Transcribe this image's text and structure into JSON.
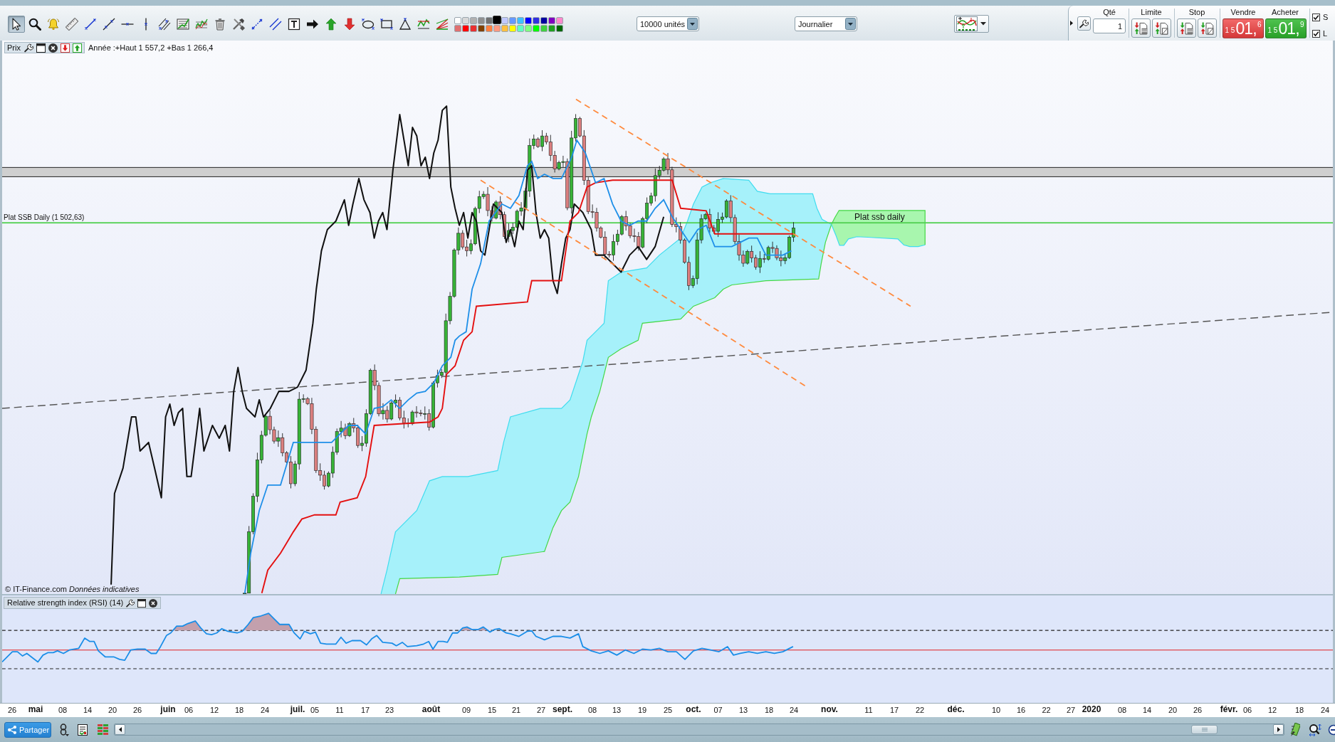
{
  "toolbar": {
    "tools": [
      {
        "kind": "pointer",
        "selected": true
      },
      {
        "kind": "zoom",
        "selected": false
      },
      {
        "kind": "alert",
        "selected": false
      },
      {
        "kind": "ruler",
        "selected": false
      },
      {
        "kind": "segment",
        "selected": false
      },
      {
        "kind": "line",
        "selected": false
      },
      {
        "kind": "horizontal",
        "selected": false
      },
      {
        "kind": "vertical",
        "selected": false
      },
      {
        "kind": "channel",
        "selected": false
      },
      {
        "kind": "retracement",
        "selected": false
      },
      {
        "kind": "waves",
        "selected": false
      },
      {
        "kind": "delete",
        "selected": false
      },
      {
        "kind": "tools",
        "selected": false
      },
      {
        "kind": "ray",
        "selected": false
      },
      {
        "kind": "parallel",
        "selected": false
      },
      {
        "kind": "text",
        "selected": false
      },
      {
        "kind": "arrow",
        "selected": false
      },
      {
        "kind": "up",
        "selected": false
      },
      {
        "kind": "down",
        "selected": false
      },
      {
        "kind": "ellipse",
        "selected": false
      },
      {
        "kind": "rectangle",
        "selected": false
      },
      {
        "kind": "triangle",
        "selected": false
      },
      {
        "kind": "pattern",
        "selected": false
      },
      {
        "kind": "fan",
        "selected": false
      }
    ],
    "palette": [
      {
        "color": "#ffffff",
        "selected": false
      },
      {
        "color": "#d8d8d8",
        "selected": false
      },
      {
        "color": "#b0b0b0",
        "selected": false
      },
      {
        "color": "#909090",
        "selected": false
      },
      {
        "color": "#707070",
        "selected": false
      },
      {
        "color": "#000000",
        "selected": true
      },
      {
        "color": "#c0c8ff",
        "selected": false
      },
      {
        "color": "#6699ff",
        "selected": false
      },
      {
        "color": "#40c0ff",
        "selected": false
      },
      {
        "color": "#0000ff",
        "selected": false
      },
      {
        "color": "#3030e0",
        "selected": false
      },
      {
        "color": "#0000a0",
        "selected": false
      },
      {
        "color": "#8000c0",
        "selected": false
      },
      {
        "color": "#ff88cc",
        "selected": false
      },
      {
        "color": "#e07070",
        "selected": false
      },
      {
        "color": "#ff0000",
        "selected": false
      },
      {
        "color": "#e83030",
        "selected": false
      },
      {
        "color": "#804000",
        "selected": false
      },
      {
        "color": "#ff8040",
        "selected": false
      },
      {
        "color": "#ff9980",
        "selected": false
      },
      {
        "color": "#ffc040",
        "selected": false
      },
      {
        "color": "#ffff00",
        "selected": false
      },
      {
        "color": "#60ffc0",
        "selected": false
      },
      {
        "color": "#80ff80",
        "selected": false
      },
      {
        "color": "#00ff00",
        "selected": false
      },
      {
        "color": "#40d040",
        "selected": false
      },
      {
        "color": "#20a020",
        "selected": false
      },
      {
        "color": "#006600",
        "selected": false
      }
    ],
    "lot_size": {
      "value": "10000 unités"
    },
    "period": {
      "value": "Journalier"
    }
  },
  "order_panel": {
    "quantity_label": "Qté",
    "quantity": "1",
    "limit_label": "Limite",
    "stop_label": "Stop",
    "sell": {
      "label": "Vendre",
      "price_prefix": "1 5",
      "price_main": "01,",
      "price_suffix": "6"
    },
    "buy": {
      "label": "Acheter",
      "price_prefix": "1 5",
      "price_main": "01,",
      "price_suffix": "9"
    },
    "options": [
      {
        "label": "S",
        "checked": true
      },
      {
        "label": "L",
        "checked": true
      }
    ]
  },
  "chart": {
    "title": "Prix",
    "summary": "Année :+Haut 1 557,2 +Bas 1 266,4",
    "level_label": "Plat SSB Daily (1 502,63)",
    "zone_label": "Plat ssb daily",
    "credit": "© IT-Finance.com *Données indicatives*"
  },
  "rsi_panel": {
    "title": "Relative strength index (RSI) (14)"
  },
  "date_axis": [
    {
      "label": "26",
      "kind": "day"
    },
    {
      "label": "mai",
      "kind": "month"
    },
    {
      "label": "08",
      "kind": "day"
    },
    {
      "label": "14",
      "kind": "day"
    },
    {
      "label": "20",
      "kind": "day"
    },
    {
      "label": "26",
      "kind": "day"
    },
    {
      "label": "juin",
      "kind": "month"
    },
    {
      "label": "06",
      "kind": "day"
    },
    {
      "label": "12",
      "kind": "day"
    },
    {
      "label": "18",
      "kind": "day"
    },
    {
      "label": "24",
      "kind": "day"
    },
    {
      "label": "juil.",
      "kind": "month"
    },
    {
      "label": "05",
      "kind": "day"
    },
    {
      "label": "11",
      "kind": "day"
    },
    {
      "label": "17",
      "kind": "day"
    },
    {
      "label": "23",
      "kind": "day"
    },
    {
      "label": "août",
      "kind": "month"
    },
    {
      "label": "09",
      "kind": "day"
    },
    {
      "label": "15",
      "kind": "day"
    },
    {
      "label": "21",
      "kind": "day"
    },
    {
      "label": "27",
      "kind": "day"
    },
    {
      "label": "sept.",
      "kind": "month"
    },
    {
      "label": "08",
      "kind": "day"
    },
    {
      "label": "13",
      "kind": "day"
    },
    {
      "label": "19",
      "kind": "day"
    },
    {
      "label": "25",
      "kind": "day"
    },
    {
      "label": "oct.",
      "kind": "month"
    },
    {
      "label": "07",
      "kind": "day"
    },
    {
      "label": "13",
      "kind": "day"
    },
    {
      "label": "18",
      "kind": "day"
    },
    {
      "label": "24",
      "kind": "day"
    },
    {
      "label": "nov.",
      "kind": "month"
    },
    {
      "label": "11",
      "kind": "day"
    },
    {
      "label": "17",
      "kind": "day"
    },
    {
      "label": "22",
      "kind": "day"
    },
    {
      "label": "déc.",
      "kind": "month"
    },
    {
      "label": "10",
      "kind": "day"
    },
    {
      "label": "16",
      "kind": "day"
    },
    {
      "label": "22",
      "kind": "day"
    },
    {
      "label": "27",
      "kind": "day"
    },
    {
      "label": "2020",
      "kind": "month"
    },
    {
      "label": "08",
      "kind": "day"
    },
    {
      "label": "14",
      "kind": "day"
    },
    {
      "label": "20",
      "kind": "day"
    },
    {
      "label": "26",
      "kind": "day"
    },
    {
      "label": "févr.",
      "kind": "month"
    },
    {
      "label": "06",
      "kind": "day"
    },
    {
      "label": "12",
      "kind": "day"
    },
    {
      "label": "18",
      "kind": "day"
    },
    {
      "label": "24",
      "kind": "day"
    }
  ],
  "bottom_bar": {
    "share_button": "Partager"
  }
}
